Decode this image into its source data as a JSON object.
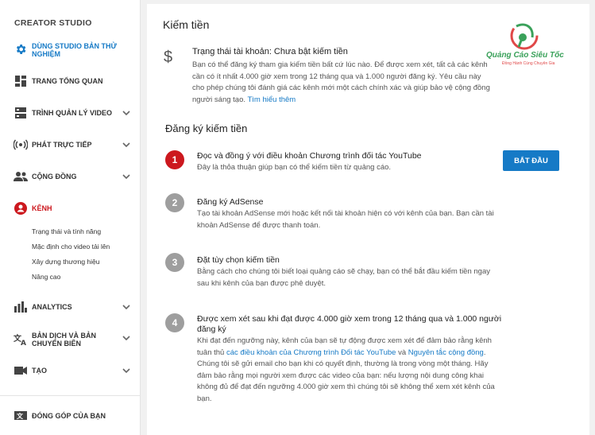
{
  "sidebar": {
    "title": "CREATOR STUDIO",
    "items": [
      {
        "label": "DÙNG STUDIO BẢN THỬ NGHIỆM",
        "icon": "gear-icon",
        "color": "#167ac6"
      },
      {
        "label": "TRANG TỔNG QUAN",
        "icon": "dashboard-icon"
      },
      {
        "label": "TRÌNH QUẢN LÝ VIDEO",
        "icon": "video-manager-icon"
      },
      {
        "label": "PHÁT TRỰC TIẾP",
        "icon": "live-icon"
      },
      {
        "label": "CỘNG ĐỒNG",
        "icon": "community-icon"
      },
      {
        "label": "KÊNH",
        "icon": "channel-icon",
        "color": "#cc181e"
      },
      {
        "label": "ANALYTICS",
        "icon": "analytics-icon"
      },
      {
        "label": "BẢN DỊCH VÀ BẢN CHUYỂN BIÊN",
        "icon": "translate-icon"
      },
      {
        "label": "TẠO",
        "icon": "create-icon"
      },
      {
        "label": "ĐÓNG GÓP CỦA BẠN",
        "icon": "contribute-icon"
      }
    ],
    "channel_sub": [
      "Trạng thái và tính năng",
      "Mặc định cho video tải lên",
      "Xây dựng thương hiệu",
      "Nâng cao"
    ]
  },
  "main": {
    "title": "Kiếm tiền",
    "status_title": "Trạng thái tài khoản: Chưa bật kiếm tiền",
    "status_body": "Bạn có thể đăng ký tham gia kiếm tiền bất cứ lúc nào. Để được xem xét, tất cả các kênh cần có ít nhất 4.000 giờ xem trong 12 tháng qua và 1.000 người đăng ký. Yêu cầu này cho phép chúng tôi đánh giá các kênh mới một cách chính xác và giúp bảo vệ cộng đồng người sáng tạo.",
    "status_link": "Tìm hiểu thêm",
    "signup_title": "Đăng ký kiếm tiền",
    "start_button": "BẮT ĐẦU",
    "steps": [
      {
        "num": "1",
        "title": "Đọc và đồng ý với điều khoản Chương trình đối tác YouTube",
        "desc": "Đây là thỏa thuận giúp bạn có thể kiếm tiền từ quảng cáo."
      },
      {
        "num": "2",
        "title": "Đăng ký AdSense",
        "desc": "Tạo tài khoản AdSense mới hoặc kết nối tài khoản hiện có với kênh của bạn. Bạn cần tài khoản AdSense để được thanh toán."
      },
      {
        "num": "3",
        "title": "Đặt tùy chọn kiếm tiền",
        "desc": "Bằng cách cho chúng tôi biết loại quảng cáo sẽ chạy, bạn có thể bắt đầu kiếm tiền ngay sau khi kênh của bạn được phê duyệt."
      },
      {
        "num": "4",
        "title": "Được xem xét sau khi đạt được 4.000 giờ xem trong 12 tháng qua và 1.000 người đăng ký",
        "desc_a": "Khi đạt đến ngưỡng này, kênh của bạn sẽ tự động được xem xét để đảm bảo rằng kênh tuân thủ ",
        "desc_link": "các điều khoản của Chương trình Đối tác YouTube",
        "desc_b": " và ",
        "desc_link2": "Nguyên tắc cộng đồng",
        "desc_c": ". Chúng tôi sẽ gửi email cho bạn khi có quyết định, thường là trong vòng một tháng. Hãy đảm bảo rằng mọi người xem được các video của bạn: nếu lượng nội dung công khai không đủ để đạt đến ngưỡng 4.000 giờ xem thì chúng tôi sẽ không thể xem xét kênh của bạn."
      }
    ],
    "colors": {
      "active_step": "#cc181e",
      "inactive_step": "#9e9e9e",
      "accent": "#167ac6"
    }
  },
  "watermark": {
    "name": "Quảng Cáo Siêu Tốc",
    "tagline": "Đồng Hành Cùng Chuyên Gia"
  }
}
